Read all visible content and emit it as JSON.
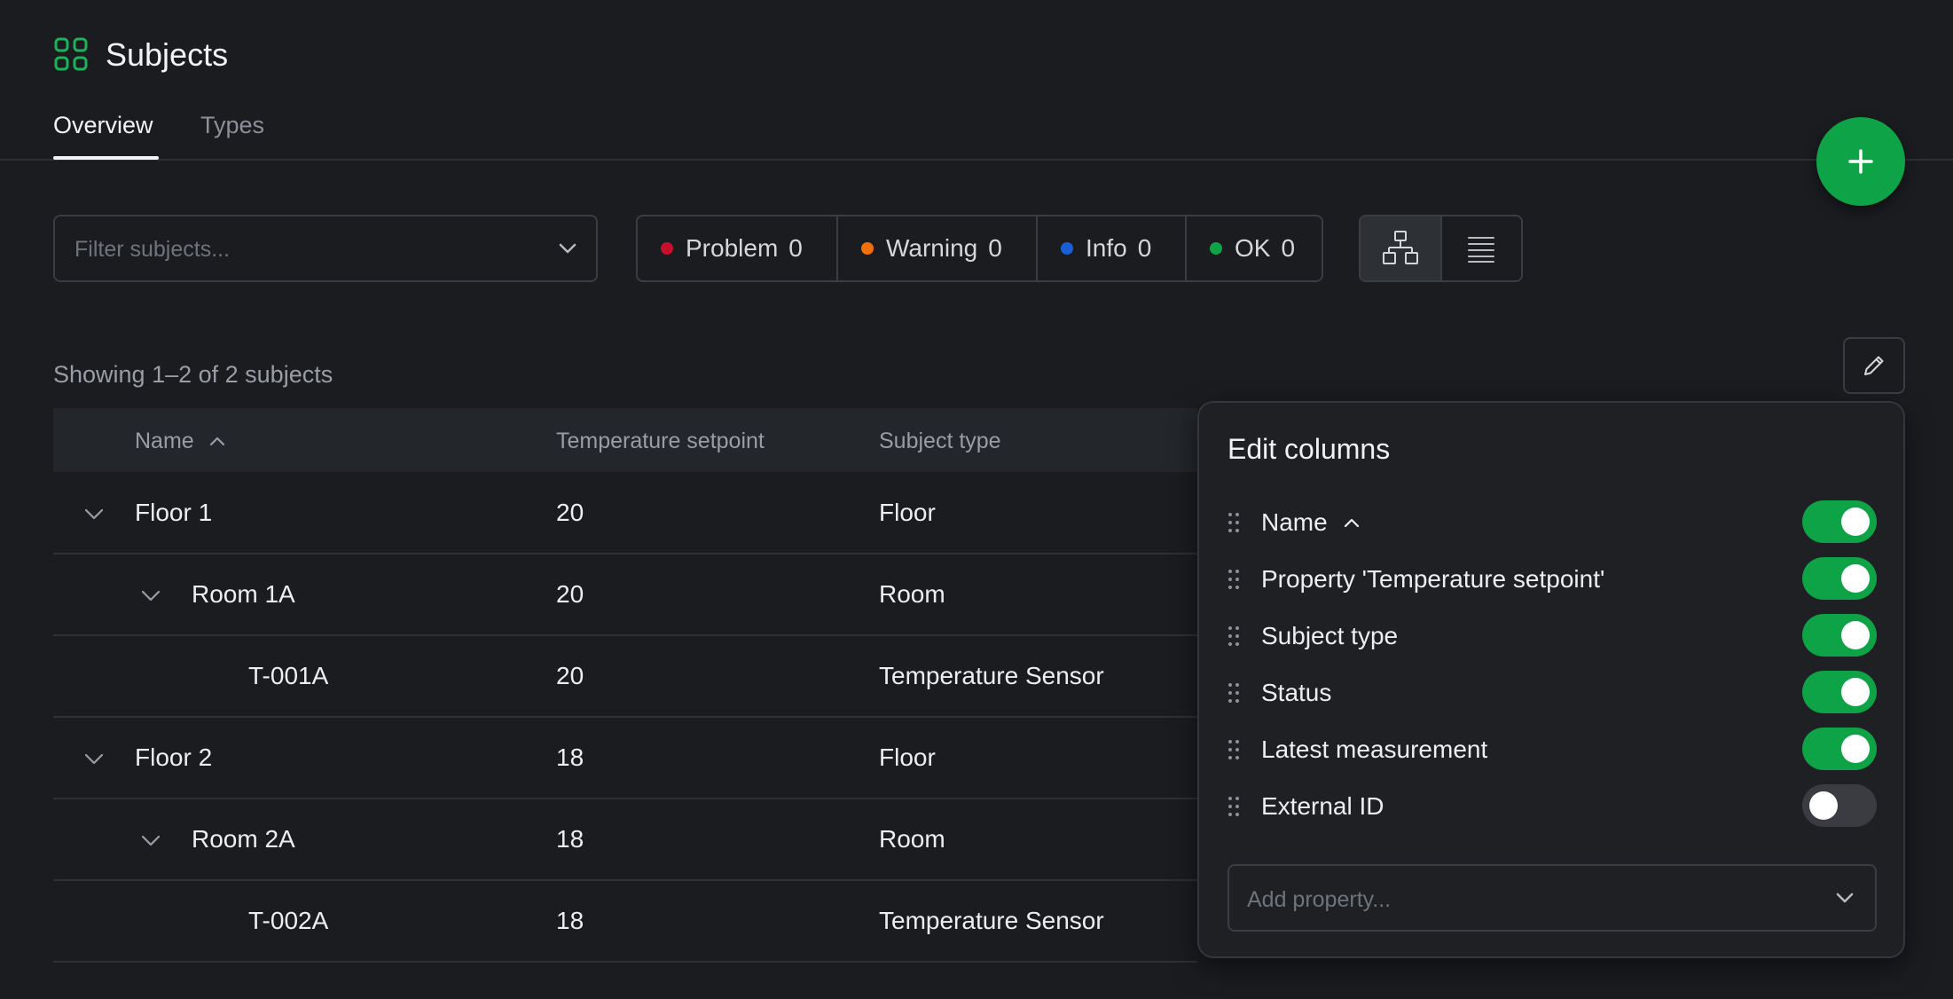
{
  "header": {
    "title": "Subjects",
    "icon": "grid-icon",
    "tabs": [
      {
        "label": "Overview",
        "active": true
      },
      {
        "label": "Types",
        "active": false
      }
    ],
    "add_button_icon": "plus-icon"
  },
  "filter": {
    "placeholder": "Filter subjects..."
  },
  "status_filters": [
    {
      "label": "Problem",
      "count": "0",
      "color": "#c8102e"
    },
    {
      "label": "Warning",
      "count": "0",
      "color": "#f0700a"
    },
    {
      "label": "Info",
      "count": "0",
      "color": "#1a5fd6"
    },
    {
      "label": "OK",
      "count": "0",
      "color": "#0fa348"
    }
  ],
  "view_toggle": {
    "tree_icon": "hierarchy-icon",
    "list_icon": "list-icon",
    "active": "tree"
  },
  "summary": "Showing 1–2 of 2 subjects",
  "table": {
    "columns": [
      "Name",
      "Temperature setpoint",
      "Subject type"
    ],
    "sort_column": "Name",
    "sort_direction": "ascending",
    "rows": [
      {
        "name": "Floor 1",
        "setpoint": "20",
        "type": "Floor",
        "level": 0,
        "expandable": true
      },
      {
        "name": "Room 1A",
        "setpoint": "20",
        "type": "Room",
        "level": 1,
        "expandable": true
      },
      {
        "name": "T-001A",
        "setpoint": "20",
        "type": "Temperature Sensor",
        "level": 2,
        "expandable": false
      },
      {
        "name": "Floor 2",
        "setpoint": "18",
        "type": "Floor",
        "level": 0,
        "expandable": true
      },
      {
        "name": "Room 2A",
        "setpoint": "18",
        "type": "Room",
        "level": 1,
        "expandable": true
      },
      {
        "name": "T-002A",
        "setpoint": "18",
        "type": "Temperature Sensor",
        "level": 2,
        "expandable": false
      }
    ]
  },
  "edit_columns": {
    "title": "Edit columns",
    "items": [
      {
        "label": "Name",
        "enabled": true,
        "sorted": true
      },
      {
        "label": "Property 'Temperature setpoint'",
        "enabled": true
      },
      {
        "label": "Subject type",
        "enabled": true
      },
      {
        "label": "Status",
        "enabled": true
      },
      {
        "label": "Latest measurement",
        "enabled": true
      },
      {
        "label": "External ID",
        "enabled": false
      }
    ],
    "add_placeholder": "Add property..."
  },
  "colors": {
    "background": "#1b1c20",
    "accent": "#0fa348",
    "border": "#3a3d44"
  }
}
